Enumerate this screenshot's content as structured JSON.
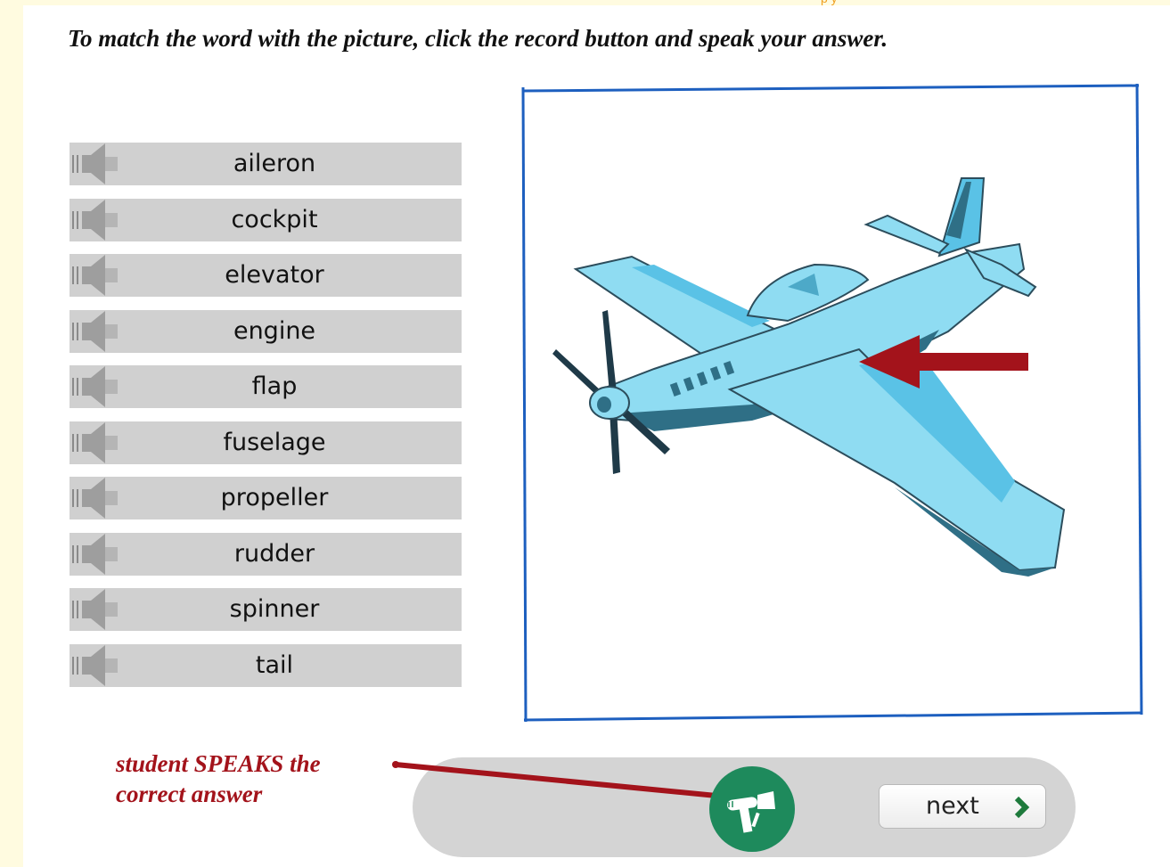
{
  "header": {
    "cut_text": "p                   y"
  },
  "instruction": "To match the word with the picture, click the record button and speak your answer.",
  "words": [
    {
      "label": "aileron"
    },
    {
      "label": "cockpit"
    },
    {
      "label": "elevator"
    },
    {
      "label": "engine"
    },
    {
      "label": "flap"
    },
    {
      "label": "fuselage"
    },
    {
      "label": "propeller"
    },
    {
      "label": "rudder"
    },
    {
      "label": "spinner"
    },
    {
      "label": "tail"
    }
  ],
  "annotation": {
    "line1": "student SPEAKS the",
    "line2": "correct answer"
  },
  "controls": {
    "next_label": "next"
  },
  "colors": {
    "accent_red": "#a3131b",
    "record_green": "#1e8a5c",
    "frame_blue": "#1d5fbf",
    "plane_blue": "#8fdcf2"
  }
}
